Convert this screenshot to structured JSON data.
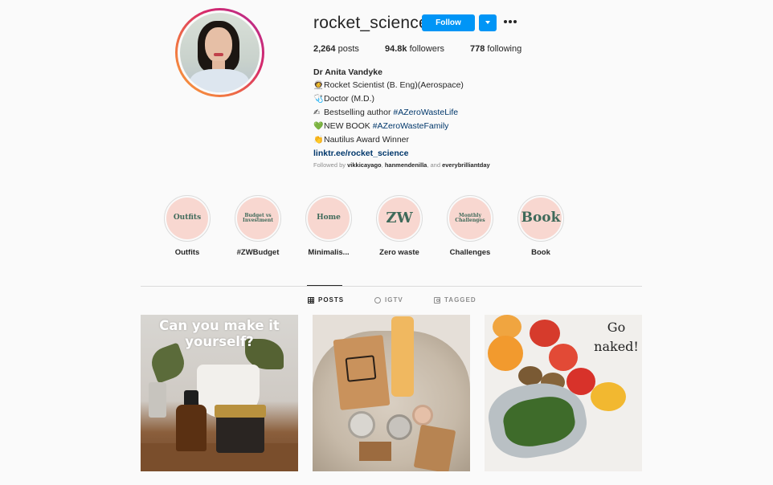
{
  "profile": {
    "username": "rocket_science",
    "follow_label": "Follow",
    "stats": {
      "posts_count": "2,264",
      "posts_label": "posts",
      "followers_count": "94.8k",
      "followers_label": "followers",
      "following_count": "778",
      "following_label": "following"
    },
    "bio": {
      "name": "Dr Anita Vandyke",
      "line1_emoji": "👩‍🚀",
      "line1_text": "Rocket Scientist (B. Eng)(Aerospace)",
      "line2_emoji": "🩺",
      "line2_text": "Doctor (M.D.)",
      "line3_emoji": "✍",
      "line3_text": "Bestselling author ",
      "line3_tag": "#AZeroWasteLife",
      "line4_emoji": "💚",
      "line4_text": "NEW BOOK ",
      "line4_tag": "#AZeroWasteFamily",
      "line5_emoji": "👏",
      "line5_text": "Nautilus Award Winner",
      "link": "linktr.ee/rocket_science"
    },
    "followed_by": {
      "prefix": "Followed by ",
      "user1": "vikkicayago",
      "sep1": ", ",
      "user2": "hanmendenilla",
      "sep2": ", and ",
      "user3": "everybrilliantday"
    }
  },
  "highlights": [
    {
      "cover": "Outfits",
      "label": "Outfits"
    },
    {
      "cover": "Budget vs Investment",
      "label": "#ZWBudget"
    },
    {
      "cover": "Home",
      "label": "Minimalis..."
    },
    {
      "cover": "ZW",
      "label": "Zero waste"
    },
    {
      "cover": "Monthly Challenges",
      "label": "Challenges"
    },
    {
      "cover": "Book",
      "label": "Book"
    }
  ],
  "tabs": {
    "posts": "POSTS",
    "igtv": "IGTV",
    "tagged": "TAGGED"
  },
  "posts": [
    {
      "overlay_text": "Can you make it yourself?"
    },
    {
      "overlay_text": ""
    },
    {
      "overlay_text": "Go naked!"
    }
  ],
  "colors": {
    "accent": "#0095f6",
    "link": "#00376b",
    "highlight_bg": "#f8d7d0",
    "highlight_text": "#3f6a5a"
  }
}
